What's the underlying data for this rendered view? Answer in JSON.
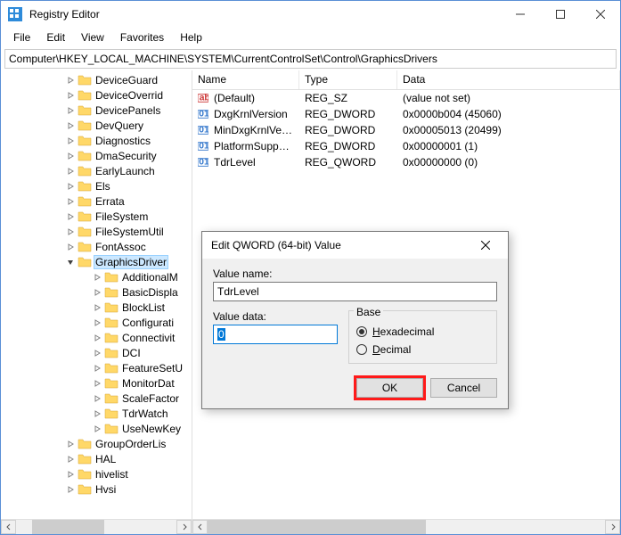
{
  "window": {
    "title": "Registry Editor"
  },
  "menu": {
    "file": "File",
    "edit": "Edit",
    "view": "View",
    "favorites": "Favorites",
    "help": "Help"
  },
  "address": "Computer\\HKEY_LOCAL_MACHINE\\SYSTEM\\CurrentControlSet\\Control\\GraphicsDrivers",
  "columns": {
    "name": "Name",
    "type": "Type",
    "data": "Data"
  },
  "tree": [
    "DeviceGuard",
    "DeviceOverrid",
    "DevicePanels",
    "DevQuery",
    "Diagnostics",
    "DmaSecurity",
    "EarlyLaunch",
    "Els",
    "Errata",
    "FileSystem",
    "FileSystemUtil",
    "FontAssoc",
    "GraphicsDriver",
    "AdditionalM",
    "BasicDispla",
    "BlockList",
    "Configurati",
    "Connectivit",
    "DCI",
    "FeatureSetU",
    "MonitorDat",
    "ScaleFactor",
    "TdrWatch",
    "UseNewKey",
    "GroupOrderLis",
    "HAL",
    "hivelist",
    "Hvsi"
  ],
  "values": [
    {
      "name": "(Default)",
      "type": "REG_SZ",
      "data": "(value not set)",
      "icon": "str"
    },
    {
      "name": "DxgKrnlVersion",
      "type": "REG_DWORD",
      "data": "0x0000b004 (45060)",
      "icon": "bin"
    },
    {
      "name": "MinDxgKrnlVersi...",
      "type": "REG_DWORD",
      "data": "0x00005013 (20499)",
      "icon": "bin"
    },
    {
      "name": "PlatformSuppor...",
      "type": "REG_DWORD",
      "data": "0x00000001 (1)",
      "icon": "bin"
    },
    {
      "name": "TdrLevel",
      "type": "REG_QWORD",
      "data": "0x00000000 (0)",
      "icon": "bin"
    }
  ],
  "dialog": {
    "title": "Edit QWORD (64-bit) Value",
    "value_name_label": "Value name:",
    "value_name": "TdrLevel",
    "value_data_label": "Value data:",
    "value_data": "0",
    "base_label": "Base",
    "hex_label": "Hexadecimal",
    "dec_label": "Decimal",
    "ok": "OK",
    "cancel": "Cancel"
  }
}
